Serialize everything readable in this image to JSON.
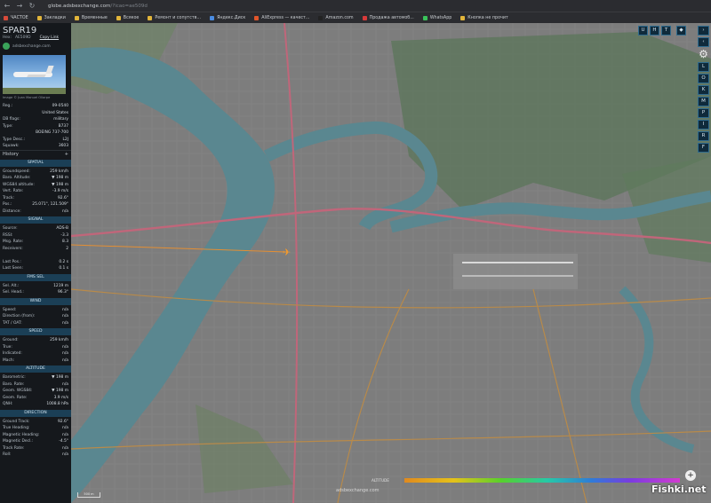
{
  "browser": {
    "url_host": "globe.adsbexchange.com",
    "url_rest": "/?icao=ae509d",
    "bookmarks": [
      {
        "label": "ЧАСТОЕ",
        "color": "#d84a3a"
      },
      {
        "label": "Закладки",
        "color": "#e2b53a"
      },
      {
        "label": "Временные",
        "color": "#e2b53a"
      },
      {
        "label": "Всякое",
        "color": "#e2b53a"
      },
      {
        "label": "Ремонт и сопутств...",
        "color": "#e2b53a"
      },
      {
        "label": "Яндекс.Диск",
        "color": "#4a8be0"
      },
      {
        "label": "AliExpress — качест...",
        "color": "#e0552a"
      },
      {
        "label": "Amazon.com",
        "color": "#222222"
      },
      {
        "label": "Продажа автомоб...",
        "color": "#d83a3a"
      },
      {
        "label": "WhatsApp",
        "color": "#3ac25a"
      },
      {
        "label": "Кнопка не прочит",
        "color": "#e2b53a"
      }
    ]
  },
  "aircraft": {
    "callsign": "SPAR19",
    "hex_label": "Hex:",
    "hex": "AE509D",
    "copy_link": "Copy Link",
    "exchange": "adsbexchange.com",
    "photo_credit": "Image © Juan Manuel Ollarpe"
  },
  "details": [
    {
      "k": "Reg.:",
      "v": "09-0540"
    },
    {
      "k": "",
      "v": "United States"
    },
    {
      "k": "DB flags:",
      "v": "military"
    },
    {
      "k": "Type:",
      "v": "B737"
    },
    {
      "k": "",
      "v": "BOEING 737-700"
    },
    {
      "k": "Type Desc.:",
      "v": "L2J"
    },
    {
      "k": "Squawk:",
      "v": "3603"
    }
  ],
  "history_label": "History",
  "history_icon": "+",
  "sections": [
    {
      "title": "SPATIAL",
      "rows": [
        {
          "k": "Groundspeed:",
          "v": "259 km/h"
        },
        {
          "k": "Baro. Altitude:",
          "v": "▼ 198 m"
        },
        {
          "k": "WGS84 altitude:",
          "v": "▼ 198 m"
        },
        {
          "k": "Vert. Rate:",
          "v": "-3.9 m/s"
        },
        {
          "k": "Track:",
          "v": "92.6°"
        },
        {
          "k": "Pos.:",
          "v": "25.071°, 121.509°"
        },
        {
          "k": "Distance:",
          "v": "n/a"
        }
      ]
    },
    {
      "title": "SIGNAL",
      "rows": [
        {
          "k": "Source:",
          "v": "ADS-B"
        },
        {
          "k": "RSSI:",
          "v": "-3.3"
        },
        {
          "k": "Msg. Rate:",
          "v": "8.3"
        },
        {
          "k": "Receivers:",
          "v": "2"
        },
        {
          "k": "",
          "v": ""
        },
        {
          "k": "Last Pos.:",
          "v": "0.2 s"
        },
        {
          "k": "Last Seen:",
          "v": "0.1 s"
        }
      ]
    },
    {
      "title": "FMS SEL",
      "rows": [
        {
          "k": "Sel. Alt.:",
          "v": "1219 m"
        },
        {
          "k": "Sel. Head.:",
          "v": "96.3°"
        }
      ]
    },
    {
      "title": "WIND",
      "rows": [
        {
          "k": "Speed:",
          "v": "n/a"
        },
        {
          "k": "Direction (from):",
          "v": "n/a"
        },
        {
          "k": "TAT / OAT:",
          "v": "n/a"
        }
      ]
    },
    {
      "title": "SPEED",
      "rows": [
        {
          "k": "Ground:",
          "v": "259 km/h"
        },
        {
          "k": "True:",
          "v": "n/a"
        },
        {
          "k": "Indicated:",
          "v": "n/a"
        },
        {
          "k": "Mach:",
          "v": "n/a"
        }
      ]
    },
    {
      "title": "ALTITUDE",
      "rows": [
        {
          "k": "Barometric:",
          "v": "▼ 198 m"
        },
        {
          "k": "Baro. Rate:",
          "v": "n/a"
        },
        {
          "k": "Geom. WGS84:",
          "v": "▼ 198 m"
        },
        {
          "k": "Geom. Rate:",
          "v": "3.9 m/s"
        },
        {
          "k": "QNH:",
          "v": "1008.8 hPa"
        }
      ]
    },
    {
      "title": "DIRECTION",
      "rows": [
        {
          "k": "Ground Track:",
          "v": "92.6°"
        },
        {
          "k": "True Heading:",
          "v": "n/a"
        },
        {
          "k": "Magnetic Heading:",
          "v": "n/a"
        },
        {
          "k": "Magnetic Decl.:",
          "v": "-4.5°"
        },
        {
          "k": "Track Rate:",
          "v": "n/a"
        },
        {
          "k": "Roll:",
          "v": "n/a"
        }
      ]
    }
  ],
  "map_controls": {
    "top": [
      "U",
      "H",
      "T"
    ],
    "side": [
      "L",
      "O",
      "K",
      "M",
      "P",
      "I",
      "R",
      "F"
    ],
    "zoom_in": "+",
    "attribution": "ALTITUDE",
    "map_watermark": "adsbexchange.com",
    "scale": "500 m"
  },
  "watermark": "Fishki.net"
}
